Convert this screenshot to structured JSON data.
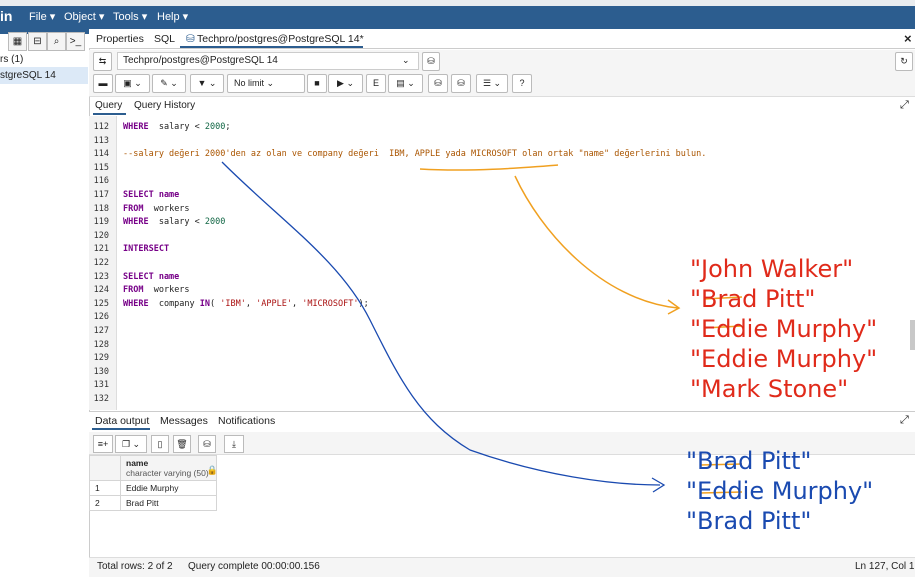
{
  "menubar": {
    "logo": "in",
    "items": [
      "File ▾",
      "Object ▾",
      "Tools ▾",
      "Help ▾"
    ]
  },
  "left_panel": {
    "tree_items": [
      "rs (1)",
      "stgreSQL 14"
    ]
  },
  "tabs": {
    "properties": "Properties",
    "sql": "SQL",
    "query_tool": "Techpro/postgres@PostgreSQL 14*",
    "close": "×"
  },
  "connection": {
    "value": "Techpro/postgres@PostgreSQL 14"
  },
  "toolbar": {
    "limit": "No limit"
  },
  "query_tabs": {
    "query": "Query",
    "history": "Query History"
  },
  "editor": {
    "lines": [
      {
        "n": "112",
        "parts": [
          [
            "kw",
            "WHERE"
          ],
          [
            "",
            "  salary < "
          ],
          [
            "num",
            "2000"
          ],
          [
            "",
            ";"
          ]
        ]
      },
      {
        "n": "113",
        "parts": []
      },
      {
        "n": "114",
        "parts": [
          [
            "cm",
            "--salary değeri 2000'den az olan ve company değeri  IBM, APPLE yada MICROSOFT olan ortak \"name\" değerlerini bulun."
          ]
        ]
      },
      {
        "n": "115",
        "parts": []
      },
      {
        "n": "116",
        "parts": []
      },
      {
        "n": "117",
        "parts": [
          [
            "kw",
            "SELECT name"
          ]
        ]
      },
      {
        "n": "118",
        "parts": [
          [
            "kw",
            "FROM"
          ],
          [
            "",
            "  workers"
          ]
        ]
      },
      {
        "n": "119",
        "parts": [
          [
            "kw",
            "WHERE"
          ],
          [
            "",
            "  salary < "
          ],
          [
            "num",
            "2000"
          ]
        ]
      },
      {
        "n": "120",
        "parts": []
      },
      {
        "n": "121",
        "parts": [
          [
            "kw",
            "INTERSECT"
          ]
        ]
      },
      {
        "n": "122",
        "parts": []
      },
      {
        "n": "123",
        "parts": [
          [
            "kw",
            "SELECT name"
          ]
        ]
      },
      {
        "n": "124",
        "parts": [
          [
            "kw",
            "FROM"
          ],
          [
            "",
            "  workers"
          ]
        ]
      },
      {
        "n": "125",
        "parts": [
          [
            "kw",
            "WHERE"
          ],
          [
            "",
            "  company "
          ],
          [
            "kw",
            "IN"
          ],
          [
            "",
            "( "
          ],
          [
            "str",
            "'IBM'"
          ],
          [
            "",
            ", "
          ],
          [
            "str",
            "'APPLE'"
          ],
          [
            "",
            ", "
          ],
          [
            "str",
            "'MICROSOFT'"
          ],
          [
            "",
            ");"
          ]
        ]
      },
      {
        "n": "126",
        "parts": []
      },
      {
        "n": "127",
        "parts": []
      },
      {
        "n": "128",
        "parts": []
      },
      {
        "n": "129",
        "parts": []
      },
      {
        "n": "130",
        "parts": []
      },
      {
        "n": "131",
        "parts": []
      },
      {
        "n": "132",
        "parts": []
      }
    ]
  },
  "output_tabs": {
    "data_output": "Data output",
    "messages": "Messages",
    "notifications": "Notifications"
  },
  "grid": {
    "column": {
      "name": "name",
      "type": "character varying (50)"
    },
    "rows": [
      {
        "idx": "1",
        "value": "Eddie Murphy"
      },
      {
        "idx": "2",
        "value": "Brad Pitt"
      }
    ]
  },
  "status": {
    "total_rows": "Total rows: 2 of 2",
    "query_complete": "Query complete 00:00:00.156",
    "cursor": "Ln 127, Col 1"
  },
  "annotations": {
    "red_list": [
      "\"John Walker\"",
      "\"Brad Pitt\"",
      "\"Eddie Murphy\"",
      "\"Eddie Murphy\"",
      "\"Mark Stone\""
    ],
    "blue_list": [
      "\"Brad Pitt\"",
      "\"Eddie Murphy\"",
      "\"Brad Pitt\""
    ],
    "colors": {
      "red": "#e02a1a",
      "blue": "#1a4ab0",
      "orange": "#f0a020"
    }
  }
}
